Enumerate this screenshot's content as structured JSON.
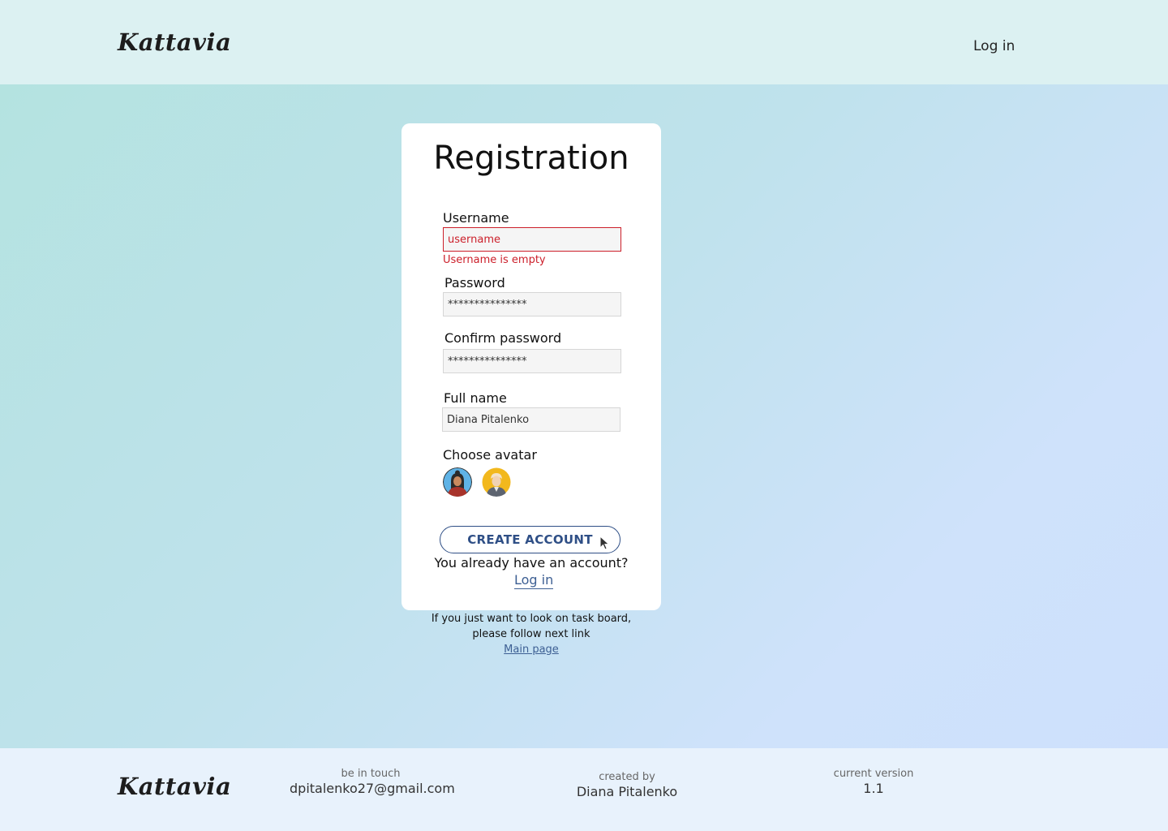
{
  "header": {
    "logo": "Kattavia",
    "login_link": "Log in"
  },
  "form": {
    "title": "Registration",
    "username": {
      "label": "Username",
      "value": "",
      "placeholder": "username",
      "error": "Username is empty"
    },
    "password": {
      "label": "Password",
      "value": "***************"
    },
    "confirm_password": {
      "label": "Confirm password",
      "value": "***************"
    },
    "full_name": {
      "label": "Full name",
      "value": "Diana Pitalenko"
    },
    "avatar": {
      "label": "Choose avatar"
    },
    "create_button": "CREATE ACCOUNT",
    "already_text": "You already have an account?",
    "login_link": "Log in"
  },
  "hint": {
    "line1": "If you just want to look on task board,",
    "line2": "please follow next link",
    "main_link": "Main page"
  },
  "footer": {
    "logo": "Kattavia",
    "contact_label": "be in touch",
    "contact_email": "dpitalenko27@gmail.com",
    "creator_label": "created by",
    "creator_name": "Diana Pitalenko",
    "version_label": "current version",
    "version": "1.1"
  },
  "colors": {
    "accent": "#2f4f86",
    "link": "#3d5f93",
    "error": "#cc1f2a",
    "header_bg": "#dcf1f2",
    "footer_bg": "#e8f2fc"
  },
  "icons": [
    "avatar-woman-icon",
    "avatar-man-icon",
    "mouse-pointer-icon"
  ]
}
